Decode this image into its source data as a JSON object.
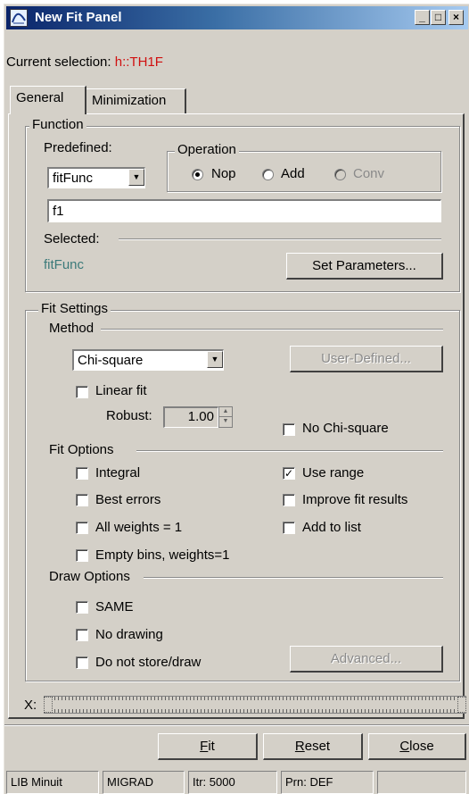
{
  "window": {
    "title": "New Fit Panel",
    "minimize": "_",
    "maximize": "□",
    "close": "×"
  },
  "selection": {
    "label": "Current selection:",
    "value": "h::TH1F",
    "value_color": "#d01010"
  },
  "tabs": [
    {
      "label": "General",
      "active": true
    },
    {
      "label": "Minimization",
      "active": false
    }
  ],
  "function_group": {
    "title": "Function",
    "predefined_label": "Predefined:",
    "predefined_value": "fitFunc",
    "operation": {
      "title": "Operation",
      "options": [
        {
          "label": "Nop",
          "selected": true,
          "enabled": true
        },
        {
          "label": "Add",
          "selected": false,
          "enabled": true
        },
        {
          "label": "Conv",
          "selected": false,
          "enabled": false
        }
      ]
    },
    "formula_value": "f1",
    "selected_label": "Selected:",
    "selected_value": "fitFunc",
    "set_parameters_button": "Set Parameters..."
  },
  "fit_settings": {
    "title": "Fit Settings",
    "method_label": "Method",
    "method_value": "Chi-square",
    "user_defined_button": "User-Defined...",
    "linear_fit": {
      "label": "Linear fit",
      "checked": false
    },
    "robust_label": "Robust:",
    "robust_value": "1.00",
    "no_chi_square": {
      "label": "No Chi-square",
      "checked": false
    },
    "fit_options_label": "Fit Options",
    "fit_options": {
      "integral": {
        "label": "Integral",
        "checked": false
      },
      "use_range": {
        "label": "Use range",
        "checked": true
      },
      "best_errors": {
        "label": "Best errors",
        "checked": false
      },
      "improve_fit": {
        "label": "Improve fit results",
        "checked": false
      },
      "all_weights": {
        "label": "All weights = 1",
        "checked": false
      },
      "add_to_list": {
        "label": "Add to list",
        "checked": false
      },
      "empty_bins": {
        "label": "Empty bins, weights=1",
        "checked": false
      }
    },
    "draw_options_label": "Draw Options",
    "draw_options": {
      "same": {
        "label": "SAME",
        "checked": false
      },
      "no_drawing": {
        "label": "No drawing",
        "checked": false
      },
      "do_not_store": {
        "label": "Do not store/draw",
        "checked": false
      }
    },
    "advanced_button": "Advanced..."
  },
  "range": {
    "label": "X:",
    "min_fraction": 0.0,
    "max_fraction": 1.0
  },
  "buttons": {
    "fit": {
      "mnemonic": "F",
      "rest": "it"
    },
    "reset": {
      "mnemonic": "R",
      "rest": "eset"
    },
    "close": {
      "mnemonic": "C",
      "rest": "lose"
    }
  },
  "status": [
    "LIB Minuit",
    "MIGRAD",
    "Itr: 5000",
    "Prn: DEF",
    ""
  ],
  "colors": {
    "face": "#d4d0c8",
    "title_gradient_start": "#0a246a",
    "title_gradient_end": "#a6caf0",
    "selected_function_color": "#3c7a7a"
  }
}
